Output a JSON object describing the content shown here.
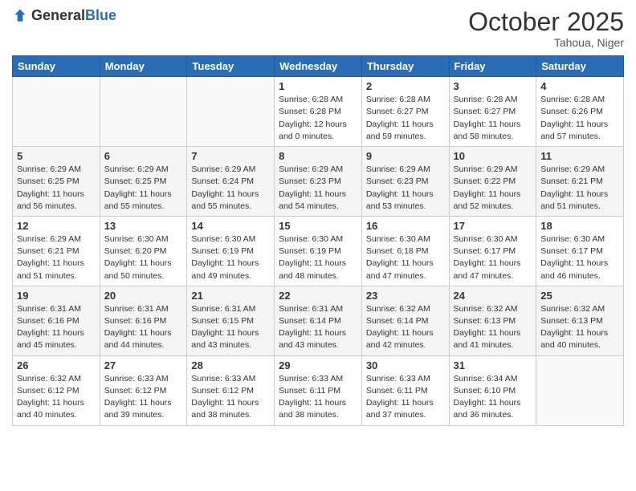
{
  "header": {
    "logo_general": "General",
    "logo_blue": "Blue",
    "month_title": "October 2025",
    "location": "Tahoua, Niger"
  },
  "days_of_week": [
    "Sunday",
    "Monday",
    "Tuesday",
    "Wednesday",
    "Thursday",
    "Friday",
    "Saturday"
  ],
  "weeks": [
    [
      {
        "day": "",
        "sunrise": "",
        "sunset": "",
        "daylight": ""
      },
      {
        "day": "",
        "sunrise": "",
        "sunset": "",
        "daylight": ""
      },
      {
        "day": "",
        "sunrise": "",
        "sunset": "",
        "daylight": ""
      },
      {
        "day": "1",
        "sunrise": "Sunrise: 6:28 AM",
        "sunset": "Sunset: 6:28 PM",
        "daylight": "Daylight: 12 hours and 0 minutes."
      },
      {
        "day": "2",
        "sunrise": "Sunrise: 6:28 AM",
        "sunset": "Sunset: 6:27 PM",
        "daylight": "Daylight: 11 hours and 59 minutes."
      },
      {
        "day": "3",
        "sunrise": "Sunrise: 6:28 AM",
        "sunset": "Sunset: 6:27 PM",
        "daylight": "Daylight: 11 hours and 58 minutes."
      },
      {
        "day": "4",
        "sunrise": "Sunrise: 6:28 AM",
        "sunset": "Sunset: 6:26 PM",
        "daylight": "Daylight: 11 hours and 57 minutes."
      }
    ],
    [
      {
        "day": "5",
        "sunrise": "Sunrise: 6:29 AM",
        "sunset": "Sunset: 6:25 PM",
        "daylight": "Daylight: 11 hours and 56 minutes."
      },
      {
        "day": "6",
        "sunrise": "Sunrise: 6:29 AM",
        "sunset": "Sunset: 6:25 PM",
        "daylight": "Daylight: 11 hours and 55 minutes."
      },
      {
        "day": "7",
        "sunrise": "Sunrise: 6:29 AM",
        "sunset": "Sunset: 6:24 PM",
        "daylight": "Daylight: 11 hours and 55 minutes."
      },
      {
        "day": "8",
        "sunrise": "Sunrise: 6:29 AM",
        "sunset": "Sunset: 6:23 PM",
        "daylight": "Daylight: 11 hours and 54 minutes."
      },
      {
        "day": "9",
        "sunrise": "Sunrise: 6:29 AM",
        "sunset": "Sunset: 6:23 PM",
        "daylight": "Daylight: 11 hours and 53 minutes."
      },
      {
        "day": "10",
        "sunrise": "Sunrise: 6:29 AM",
        "sunset": "Sunset: 6:22 PM",
        "daylight": "Daylight: 11 hours and 52 minutes."
      },
      {
        "day": "11",
        "sunrise": "Sunrise: 6:29 AM",
        "sunset": "Sunset: 6:21 PM",
        "daylight": "Daylight: 11 hours and 51 minutes."
      }
    ],
    [
      {
        "day": "12",
        "sunrise": "Sunrise: 6:29 AM",
        "sunset": "Sunset: 6:21 PM",
        "daylight": "Daylight: 11 hours and 51 minutes."
      },
      {
        "day": "13",
        "sunrise": "Sunrise: 6:30 AM",
        "sunset": "Sunset: 6:20 PM",
        "daylight": "Daylight: 11 hours and 50 minutes."
      },
      {
        "day": "14",
        "sunrise": "Sunrise: 6:30 AM",
        "sunset": "Sunset: 6:19 PM",
        "daylight": "Daylight: 11 hours and 49 minutes."
      },
      {
        "day": "15",
        "sunrise": "Sunrise: 6:30 AM",
        "sunset": "Sunset: 6:19 PM",
        "daylight": "Daylight: 11 hours and 48 minutes."
      },
      {
        "day": "16",
        "sunrise": "Sunrise: 6:30 AM",
        "sunset": "Sunset: 6:18 PM",
        "daylight": "Daylight: 11 hours and 47 minutes."
      },
      {
        "day": "17",
        "sunrise": "Sunrise: 6:30 AM",
        "sunset": "Sunset: 6:17 PM",
        "daylight": "Daylight: 11 hours and 47 minutes."
      },
      {
        "day": "18",
        "sunrise": "Sunrise: 6:30 AM",
        "sunset": "Sunset: 6:17 PM",
        "daylight": "Daylight: 11 hours and 46 minutes."
      }
    ],
    [
      {
        "day": "19",
        "sunrise": "Sunrise: 6:31 AM",
        "sunset": "Sunset: 6:16 PM",
        "daylight": "Daylight: 11 hours and 45 minutes."
      },
      {
        "day": "20",
        "sunrise": "Sunrise: 6:31 AM",
        "sunset": "Sunset: 6:16 PM",
        "daylight": "Daylight: 11 hours and 44 minutes."
      },
      {
        "day": "21",
        "sunrise": "Sunrise: 6:31 AM",
        "sunset": "Sunset: 6:15 PM",
        "daylight": "Daylight: 11 hours and 43 minutes."
      },
      {
        "day": "22",
        "sunrise": "Sunrise: 6:31 AM",
        "sunset": "Sunset: 6:14 PM",
        "daylight": "Daylight: 11 hours and 43 minutes."
      },
      {
        "day": "23",
        "sunrise": "Sunrise: 6:32 AM",
        "sunset": "Sunset: 6:14 PM",
        "daylight": "Daylight: 11 hours and 42 minutes."
      },
      {
        "day": "24",
        "sunrise": "Sunrise: 6:32 AM",
        "sunset": "Sunset: 6:13 PM",
        "daylight": "Daylight: 11 hours and 41 minutes."
      },
      {
        "day": "25",
        "sunrise": "Sunrise: 6:32 AM",
        "sunset": "Sunset: 6:13 PM",
        "daylight": "Daylight: 11 hours and 40 minutes."
      }
    ],
    [
      {
        "day": "26",
        "sunrise": "Sunrise: 6:32 AM",
        "sunset": "Sunset: 6:12 PM",
        "daylight": "Daylight: 11 hours and 40 minutes."
      },
      {
        "day": "27",
        "sunrise": "Sunrise: 6:33 AM",
        "sunset": "Sunset: 6:12 PM",
        "daylight": "Daylight: 11 hours and 39 minutes."
      },
      {
        "day": "28",
        "sunrise": "Sunrise: 6:33 AM",
        "sunset": "Sunset: 6:12 PM",
        "daylight": "Daylight: 11 hours and 38 minutes."
      },
      {
        "day": "29",
        "sunrise": "Sunrise: 6:33 AM",
        "sunset": "Sunset: 6:11 PM",
        "daylight": "Daylight: 11 hours and 38 minutes."
      },
      {
        "day": "30",
        "sunrise": "Sunrise: 6:33 AM",
        "sunset": "Sunset: 6:11 PM",
        "daylight": "Daylight: 11 hours and 37 minutes."
      },
      {
        "day": "31",
        "sunrise": "Sunrise: 6:34 AM",
        "sunset": "Sunset: 6:10 PM",
        "daylight": "Daylight: 11 hours and 36 minutes."
      },
      {
        "day": "",
        "sunrise": "",
        "sunset": "",
        "daylight": ""
      }
    ]
  ]
}
